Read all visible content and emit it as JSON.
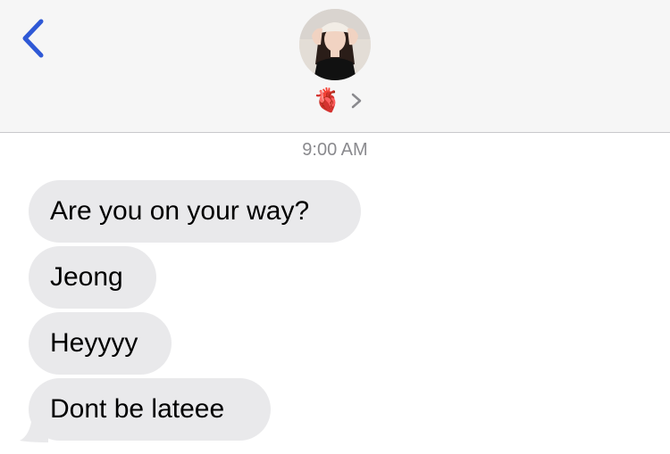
{
  "header": {
    "back_icon": "chevron-left-icon",
    "contact_emoji": "🫀",
    "chevron_icon": "chevron-right-icon"
  },
  "conversation": {
    "timestamp": "9:00 AM",
    "messages": [
      {
        "direction": "incoming",
        "text": "Are you on your way?"
      },
      {
        "direction": "incoming",
        "text": "Jeong"
      },
      {
        "direction": "incoming",
        "text": "Heyyyy"
      },
      {
        "direction": "incoming",
        "text": "Dont be lateee"
      }
    ]
  },
  "colors": {
    "accent": "#2f59d6",
    "bubble_incoming": "#e9e9eb",
    "header_bg": "#f6f6f6",
    "timestamp": "#8a8a8e"
  }
}
